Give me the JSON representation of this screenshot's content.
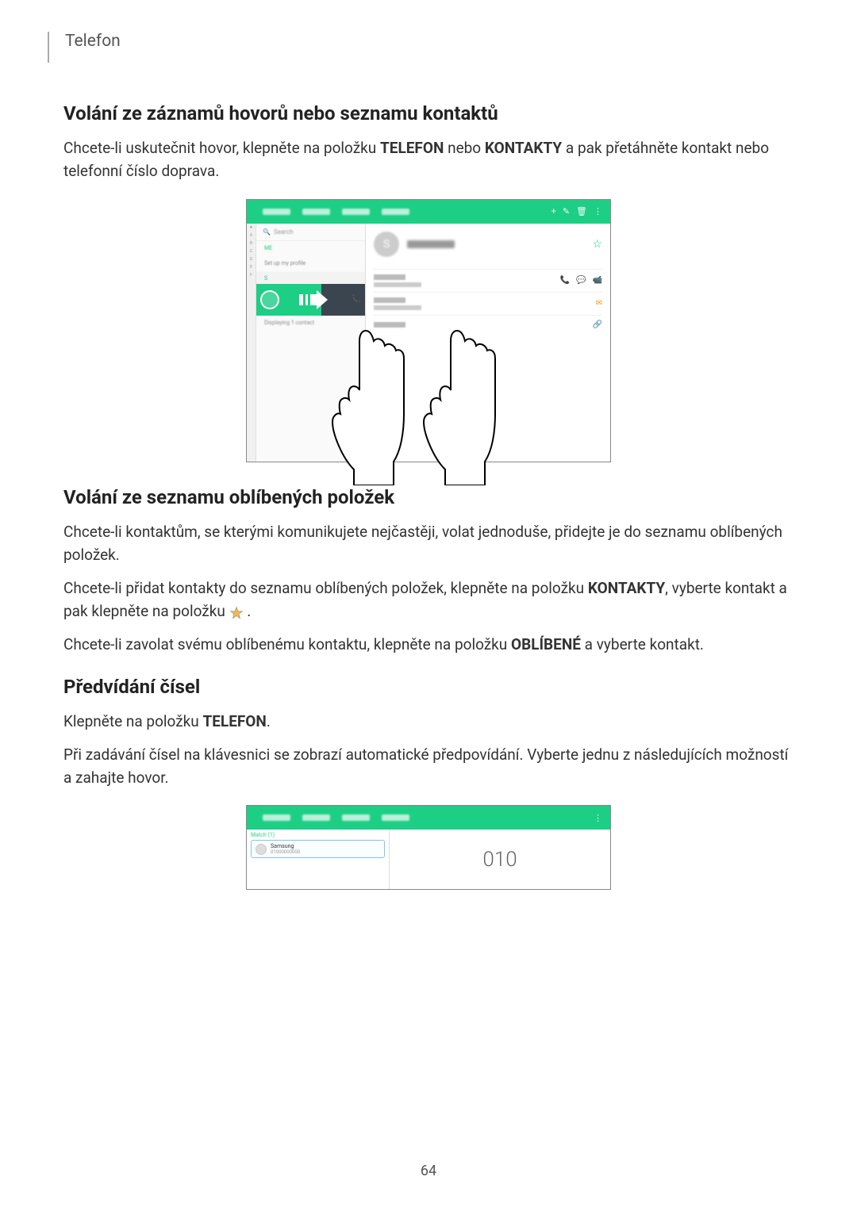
{
  "header": {
    "section": "Telefon"
  },
  "section1": {
    "heading": "Volání ze záznamů hovorů nebo seznamu kontaktů",
    "para_pre": "Chcete-li uskutečnit hovor, klepněte na položku ",
    "bold1": "TELEFON",
    "mid1": " nebo ",
    "bold2": "KONTAKTY",
    "para_post": " a pak přetáhněte kontakt nebo telefonní číslo doprava."
  },
  "figure1": {
    "dialed_number_label": "010",
    "search_placeholder": "Search",
    "contact_name": "Samsung",
    "contact_number": "01000000000"
  },
  "section2": {
    "heading": "Volání ze seznamu oblíbených položek",
    "para1": "Chcete-li kontaktům, se kterými komunikujete nejčastěji, volat jednoduše, přidejte je do seznamu oblíbených položek.",
    "para2_pre": "Chcete-li přidat kontakty do seznamu oblíbených položek, klepněte na položku ",
    "para2_bold": "KONTAKTY",
    "para2_post": ", vyberte kontakt a pak klepněte na položku ",
    "para2_end": " .",
    "para3_pre": "Chcete-li zavolat svému oblíbenému kontaktu, klepněte na položku ",
    "para3_bold": "OBLÍBENÉ",
    "para3_post": " a vyberte kontakt."
  },
  "section3": {
    "heading": "Předvídání čísel",
    "para1_pre": "Klepněte na položku ",
    "para1_bold": "TELEFON",
    "para1_post": ".",
    "para2": "Při zadávání čísel na klávesnici se zobrazí automatické předpovídání. Vyberte jednu z následujících možností a zahajte hovor."
  },
  "page_number": "64"
}
